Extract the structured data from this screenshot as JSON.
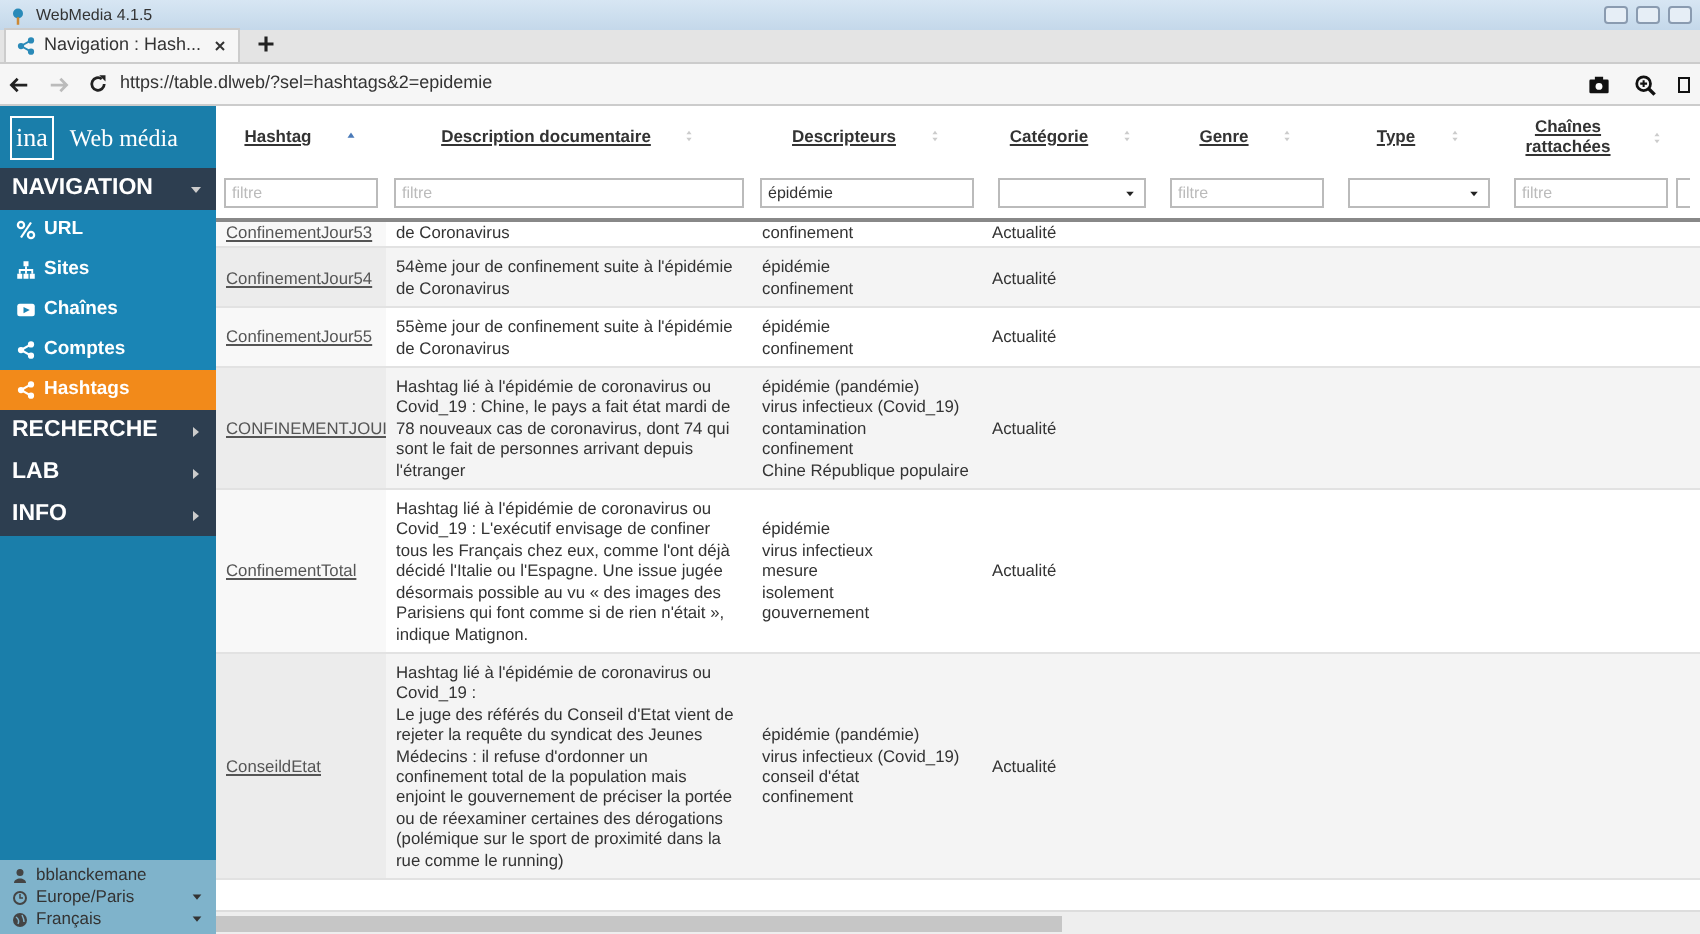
{
  "window": {
    "title": "WebMedia 4.1.5"
  },
  "browser_tabs": [
    {
      "label": "Navigation : Hash...",
      "selected": true
    }
  ],
  "address_bar": {
    "url": "https://table.dlweb/?sel=hashtags&2=epidemie",
    "forward_disabled": true
  },
  "sidebar": {
    "logo_mark": "ina",
    "logo_text": "Web média",
    "sections": [
      {
        "label": "NAVIGATION",
        "expanded": true,
        "items": [
          {
            "label": "URL",
            "selected": false
          },
          {
            "label": "Sites",
            "selected": false
          },
          {
            "label": "Chaînes",
            "selected": false
          },
          {
            "label": "Comptes",
            "selected": false
          },
          {
            "label": "Hashtags",
            "selected": true
          }
        ]
      },
      {
        "label": "RECHERCHE",
        "expanded": false
      },
      {
        "label": "LAB",
        "expanded": false
      },
      {
        "label": "INFO",
        "expanded": false
      }
    ],
    "footer": [
      {
        "kind": "user",
        "label": "bblanckemane"
      },
      {
        "kind": "timezone",
        "label": "Europe/Paris"
      },
      {
        "kind": "language",
        "label": "Français"
      }
    ]
  },
  "table": {
    "columns": [
      {
        "label": "Hashtag",
        "sorted": true,
        "filter": {
          "kind": "text",
          "placeholder": "filtre"
        }
      },
      {
        "label": "Description documentaire",
        "sorted": false,
        "filter": {
          "kind": "text",
          "placeholder": "filtre"
        }
      },
      {
        "label": "Descripteurs",
        "sorted": false,
        "filter": {
          "kind": "text",
          "value": "épidémie"
        }
      },
      {
        "label": "Catégorie",
        "sorted": false,
        "filter": {
          "kind": "select"
        }
      },
      {
        "label": "Genre",
        "sorted": false,
        "filter": {
          "kind": "text",
          "placeholder": "filtre"
        }
      },
      {
        "label": "Type",
        "sorted": false,
        "filter": {
          "kind": "select"
        }
      },
      {
        "label": "Chaînes rattachées",
        "sorted": false,
        "filter": {
          "kind": "text",
          "placeholder": "filtre"
        }
      }
    ],
    "rows": [
      {
        "hashtag": "ConfinementJour53",
        "description": "de Coronavirus",
        "descriptors": [
          "confinement"
        ],
        "category": "Actualité"
      },
      {
        "hashtag": "ConfinementJour54",
        "description": "54ème jour de confinement suite à l'épidémie\nde Coronavirus",
        "descriptors": [
          "épidémie",
          "confinement"
        ],
        "category": "Actualité"
      },
      {
        "hashtag": "ConfinementJour55",
        "description": "55ème jour de confinement suite à l'épidémie\nde Coronavirus",
        "descriptors": [
          "épidémie",
          "confinement"
        ],
        "category": "Actualité"
      },
      {
        "hashtag": "CONFINEMENTJOUI",
        "description": "Hashtag lié à l'épidémie de coronavirus ou\nCovid_19 : Chine, le pays a fait état mardi de\n78 nouveaux cas de coronavirus, dont 74 qui\nsont le fait de personnes arrivant depuis\nl'étranger",
        "descriptors": [
          "épidémie (pandémie)",
          "virus infectieux (Covid_19)",
          "contamination",
          "confinement",
          "Chine République populaire"
        ],
        "category": "Actualité"
      },
      {
        "hashtag": "ConfinementTotal",
        "description": "Hashtag lié à l'épidémie de coronavirus ou\nCovid_19 : L'exécutif envisage de confiner\ntous les Français chez eux, comme l'ont déjà\ndécidé l'Italie ou l'Espagne. Une issue jugée\ndésormais possible au vu « des images des\nParisiens qui font comme si de rien n'était »,\nindique Matignon.",
        "descriptors": [
          "épidémie",
          "virus infectieux",
          "mesure",
          "isolement",
          "gouvernement"
        ],
        "category": "Actualité"
      },
      {
        "hashtag": "ConseildEtat",
        "description": "Hashtag lié à l'épidémie de coronavirus ou\nCovid_19 :\nLe juge des référés du Conseil d'Etat vient de\nrejeter la requête du syndicat des Jeunes\nMédecins : il refuse d'ordonner un\nconfinement total de la population mais\nenjoint le gouvernement de préciser la portée\nou de réexaminer certaines des dérogations\n(polémique sur le sport de proximité dans la\nrue comme le running)",
        "descriptors": [
          "épidémie (pandémie)",
          "virus infectieux (Covid_19)",
          "conseil d'état",
          "confinement"
        ],
        "category": "Actualité"
      }
    ]
  },
  "horizontal_scrollbar": {
    "level": 0.57
  }
}
